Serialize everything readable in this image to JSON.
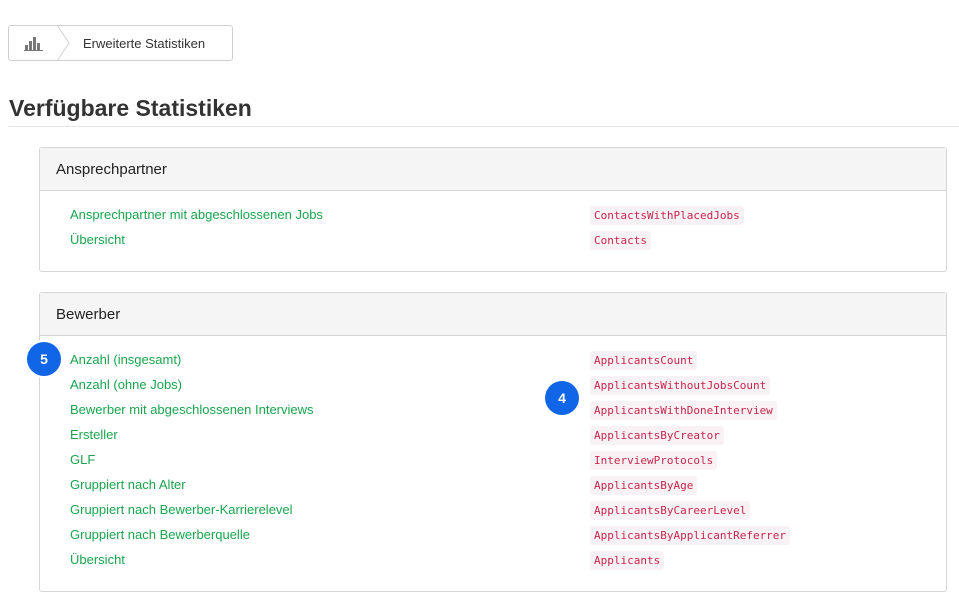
{
  "breadcrumb": {
    "icon": "bar-chart-icon",
    "label": "Erweiterte Statistiken"
  },
  "page_title": "Verfügbare Statistiken",
  "sections": [
    {
      "title": "Ansprechpartner",
      "items": [
        {
          "label": "Ansprechpartner mit abgeschlossenen Jobs",
          "code": "ContactsWithPlacedJobs"
        },
        {
          "label": "Übersicht",
          "code": "Contacts"
        }
      ]
    },
    {
      "title": "Bewerber",
      "items": [
        {
          "label": "Anzahl (insgesamt)",
          "code": "ApplicantsCount"
        },
        {
          "label": "Anzahl (ohne Jobs)",
          "code": "ApplicantsWithoutJobsCount"
        },
        {
          "label": "Bewerber mit abgeschlossenen Interviews",
          "code": "ApplicantsWithDoneInterview"
        },
        {
          "label": "Ersteller",
          "code": "ApplicantsByCreator"
        },
        {
          "label": "GLF",
          "code": "InterviewProtocols"
        },
        {
          "label": "Gruppiert nach Alter",
          "code": "ApplicantsByAge"
        },
        {
          "label": "Gruppiert nach Bewerber-Karrierelevel",
          "code": "ApplicantsByCareerLevel"
        },
        {
          "label": "Gruppiert nach Bewerberquelle",
          "code": "ApplicantsByApplicantReferrer"
        },
        {
          "label": "Übersicht",
          "code": "Applicants"
        }
      ]
    }
  ],
  "badges": {
    "first": "5",
    "second": "4"
  },
  "colors": {
    "link": "#1aa54d",
    "code": "#c7254e",
    "badge": "#1166e8"
  }
}
